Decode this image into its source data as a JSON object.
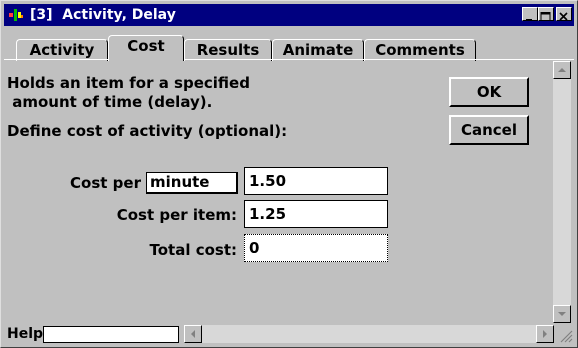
{
  "window": {
    "title": "[3]  Activity, Delay",
    "controls": [
      "minimize",
      "maximize",
      "close"
    ]
  },
  "tabs": [
    {
      "label": "Activity",
      "active": false
    },
    {
      "label": "Cost",
      "active": true
    },
    {
      "label": "Results",
      "active": false
    },
    {
      "label": "Animate",
      "active": false
    },
    {
      "label": "Comments",
      "active": false
    }
  ],
  "description": {
    "line1": "Holds an item for a specified",
    "line2": " amount of time (delay).",
    "line3": "Define cost of activity (optional):"
  },
  "buttons": {
    "ok": "OK",
    "cancel": "Cancel"
  },
  "cost": {
    "per_label": "Cost per",
    "unit": "minute",
    "per_value": "1.50",
    "item_label": "Cost per item:",
    "item_value": "1.25",
    "total_label": "Total cost:",
    "total_value": "0"
  },
  "status": {
    "help_label": "Help",
    "help_value": ""
  }
}
